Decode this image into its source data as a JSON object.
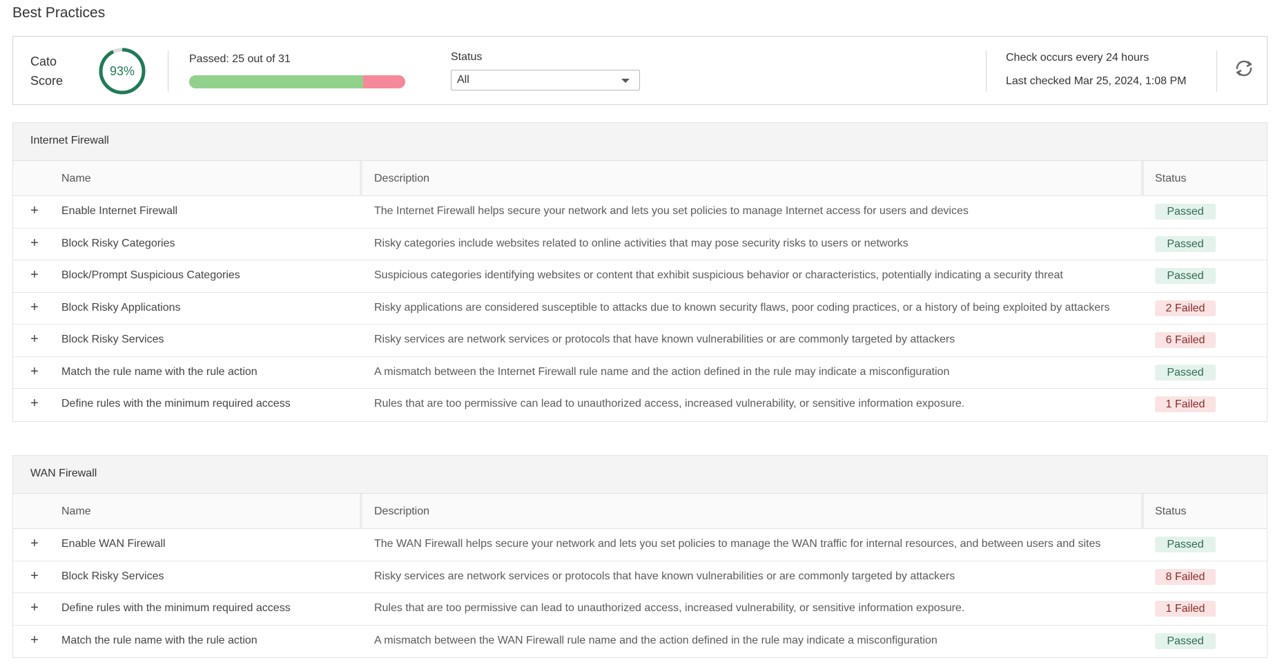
{
  "page": {
    "title": "Best Practices"
  },
  "summary": {
    "score_label_line1": "Cato",
    "score_label_line2": "Score",
    "score_percent": "93%",
    "score_fraction": 0.93,
    "passed_text": "Passed: 25 out of 31",
    "passed_fraction": 0.806,
    "status_filter_label": "Status",
    "status_filter_value": "All",
    "check_interval": "Check occurs every 24 hours",
    "last_checked": "Last checked Mar 25, 2024, 1:08 PM",
    "colors": {
      "score_ring": "#1f7a55",
      "progress_pass": "#92d18c",
      "progress_fail": "#f5899a"
    }
  },
  "columns": {
    "name": "Name",
    "description": "Description",
    "status": "Status"
  },
  "sections": [
    {
      "title": "Internet Firewall",
      "rows": [
        {
          "name": "Enable Internet Firewall",
          "description": "The Internet Firewall helps secure your network and lets you set policies to manage Internet access for users and devices",
          "status": "Passed"
        },
        {
          "name": "Block Risky Categories",
          "description": "Risky categories include websites related to online activities that may pose security risks to users or networks",
          "status": "Passed"
        },
        {
          "name": "Block/Prompt Suspicious Categories",
          "description": "Suspicious categories identifying websites or content that exhibit suspicious behavior or characteristics, potentially indicating a security threat",
          "status": "Passed"
        },
        {
          "name": "Block Risky Applications",
          "description": "Risky applications are considered susceptible to attacks due to known security flaws, poor coding practices, or a history of being exploited by attackers",
          "status": "2 Failed"
        },
        {
          "name": "Block Risky Services",
          "description": "Risky services are network services or protocols that have known vulnerabilities or are commonly targeted by attackers",
          "status": "6 Failed"
        },
        {
          "name": "Match the rule name with the rule action",
          "description": "A mismatch between the Internet Firewall rule name and the action defined in the rule may indicate a misconfiguration",
          "status": "Passed"
        },
        {
          "name": "Define rules with the minimum required access",
          "description": "Rules that are too permissive can lead to unauthorized access, increased vulnerability, or sensitive information exposure.",
          "status": "1 Failed"
        }
      ]
    },
    {
      "title": "WAN Firewall",
      "rows": [
        {
          "name": "Enable WAN Firewall",
          "description": "The WAN Firewall helps secure your network and lets you set policies to manage the WAN traffic for internal resources, and between users and sites",
          "status": "Passed"
        },
        {
          "name": "Block Risky Services",
          "description": "Risky services are network services or protocols that have known vulnerabilities or are commonly targeted by attackers",
          "status": "8 Failed"
        },
        {
          "name": "Define rules with the minimum required access",
          "description": "Rules that are too permissive can lead to unauthorized access, increased vulnerability, or sensitive information exposure.",
          "status": "1 Failed"
        },
        {
          "name": "Match the rule name with the rule action",
          "description": "A mismatch between the WAN Firewall rule name and the action defined in the rule may indicate a misconfiguration",
          "status": "Passed"
        }
      ]
    }
  ]
}
